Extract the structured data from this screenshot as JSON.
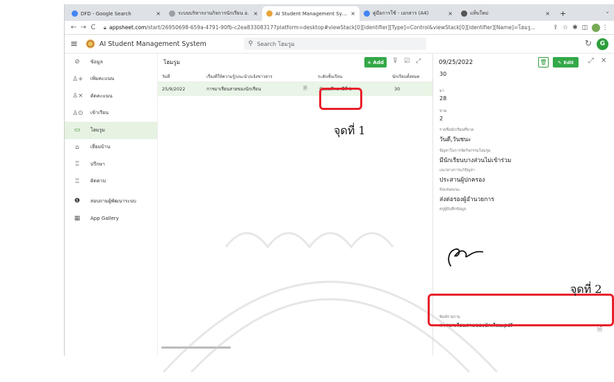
{
  "browser": {
    "tabs": [
      {
        "label": "DFD - Google Search",
        "icon_color": "#4285f4",
        "active": false
      },
      {
        "label": "ระบบบริหารงานกิจการนักเรียน อ.",
        "icon_color": "#9aa0a6",
        "active": false
      },
      {
        "label": "AI Student Management Syste",
        "icon_color": "#e8a33a",
        "active": true
      },
      {
        "label": "คู่มือการใช้ - เอกสาร (A4)",
        "icon_color": "#4285f4",
        "active": false
      },
      {
        "label": "แท็บใหม่",
        "icon_color": "#555555",
        "active": false
      }
    ],
    "url_host": "appsheet.com",
    "url_rest": "/start/26950698-659a-4791-90fb-c2ea833083177platform=desktop#viewStack[0][identifier][Type]=Control&viewStack[0][identifier][Name]=โฮมรู..."
  },
  "app": {
    "title": "AI Student Management System",
    "search_placeholder": "Search โฮมรูม",
    "user_initial": "G"
  },
  "sidebar": {
    "items": [
      {
        "label": "ข้อมูล",
        "icon": "⊘",
        "name": "info"
      },
      {
        "label": "เพิ่มคะแนน",
        "icon": "♙+",
        "name": "add-score"
      },
      {
        "label": "ตัดคะแนน",
        "icon": "♙×",
        "name": "deduct-score"
      },
      {
        "label": "เข้าเรียน",
        "icon": "♙⊙",
        "name": "attendance"
      },
      {
        "label": "โฮมรูม",
        "icon": "▭",
        "name": "homeroom",
        "active": true
      },
      {
        "label": "เยี่ยมบ้าน",
        "icon": "⌂",
        "name": "home-visit"
      },
      {
        "label": "ปรึกษา",
        "icon": "♖",
        "name": "consult"
      },
      {
        "label": "ติดตาม",
        "icon": "♖",
        "name": "follow-up"
      },
      {
        "label": "สอบถามผู้พัฒนาระบบ",
        "icon": "❶",
        "name": "contact-developer"
      },
      {
        "label": "App Gallery",
        "icon": "▦",
        "name": "app-gallery"
      }
    ]
  },
  "table": {
    "title": "โฮมรูม",
    "add_label": "+ Add",
    "columns": [
      "วันที่",
      "เรื่องที่ให้ความรู้/แนะนำ/แจ้งข่าวสาร",
      "ระดับชั้นเรียน",
      "นักเรียนทั้งหมด"
    ],
    "rows": [
      {
        "date": "25/9/2022",
        "topic": "การมาเรียนสายของนักเรียน",
        "level": "มัธยมศึกษาปีที่ 1",
        "total": "30"
      }
    ]
  },
  "detail": {
    "date": "09/25/2022",
    "edit_label": "Edit",
    "top_value": "30",
    "fields": [
      {
        "label": "มา",
        "value": "28"
      },
      {
        "label": "ขาด",
        "value": "2"
      },
      {
        "label": "รายชื่อนักเรียนที่ขาด",
        "value": "วันดี,วันชนะ"
      },
      {
        "label": "ปัญหาในการจัดกิจกรรมโฮมรูม",
        "value": "มีนักเรียนบางส่วนไม่เข้าร่วม"
      },
      {
        "label": "แนวทางการแก้ปัญหา",
        "value": "ประสานผู้ปกครอง"
      },
      {
        "label": "ข้อเสนอแนะ",
        "value": "ส่งต่อรองผู้อำนวยการ"
      },
      {
        "label": "ครูผู้บันทึกข้อมูล",
        "value": ""
      }
    ],
    "pdf_label": "พิมพ์รายงาน",
    "pdf_value": "การมาเรียนสายของนักเรียน.pdf"
  },
  "annotations": {
    "point1": "จุดที่ 1",
    "point2": "จุดที่ 2",
    "highlight_color": "#e8202a"
  }
}
